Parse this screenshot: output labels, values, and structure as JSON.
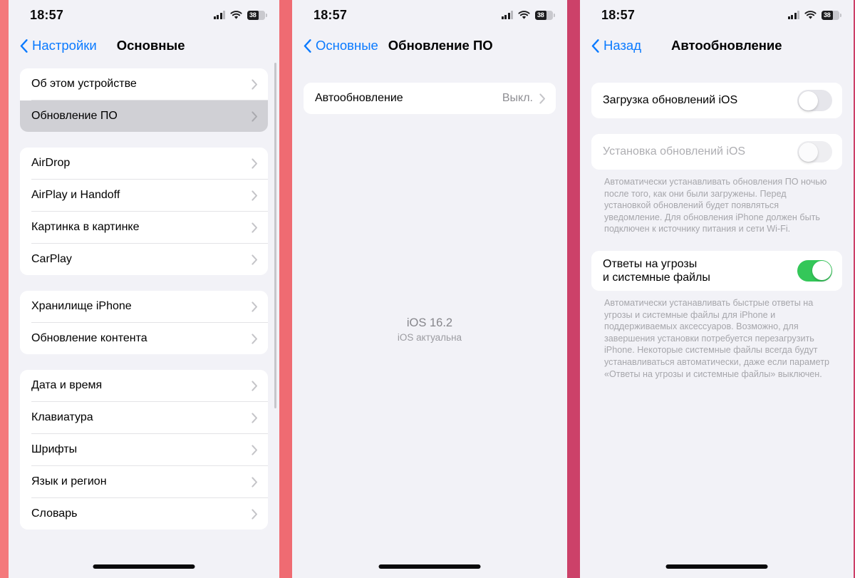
{
  "statusbar": {
    "time": "18:57",
    "battery_level": "38",
    "cell_icon": "cellular-signal-icon",
    "wifi_icon": "wifi-icon",
    "battery_icon": "battery-icon"
  },
  "screen1": {
    "back_label": "Настройки",
    "title": "Основные",
    "groups": [
      {
        "rows": [
          {
            "label": "Об этом устройстве",
            "selected": false
          },
          {
            "label": "Обновление ПО",
            "selected": true
          }
        ]
      },
      {
        "rows": [
          {
            "label": "AirDrop",
            "selected": false
          },
          {
            "label": "AirPlay и Handoff",
            "selected": false
          },
          {
            "label": "Картинка в картинке",
            "selected": false
          },
          {
            "label": "CarPlay",
            "selected": false
          }
        ]
      },
      {
        "rows": [
          {
            "label": "Хранилище iPhone",
            "selected": false
          },
          {
            "label": "Обновление контента",
            "selected": false
          }
        ]
      },
      {
        "rows": [
          {
            "label": "Дата и время",
            "selected": false
          },
          {
            "label": "Клавиатура",
            "selected": false
          },
          {
            "label": "Шрифты",
            "selected": false
          },
          {
            "label": "Язык и регион",
            "selected": false
          },
          {
            "label": "Словарь",
            "selected": false
          }
        ]
      }
    ]
  },
  "screen2": {
    "back_label": "Основные",
    "title": "Обновление ПО",
    "row": {
      "label": "Автообновление",
      "value": "Выкл."
    },
    "status": {
      "version": "iOS 16.2",
      "subtitle": "iOS актуальна"
    }
  },
  "screen3": {
    "back_label": "Назад",
    "title": "Автообновление",
    "toggle1": {
      "label": "Загрузка обновлений iOS",
      "state": "off",
      "disabled": false
    },
    "toggle2": {
      "label": "Установка обновлений iOS",
      "state": "off",
      "disabled": true
    },
    "footnote2": "Автоматически устанавливать обновления ПО ночью после того, как они были загружены. Перед установкой обновлений будет появляться уведомление. Для обновления iPhone должен быть подключен к источнику питания и сети Wi-Fi.",
    "toggle3": {
      "label_line1": "Ответы на угрозы",
      "label_line2": "и системные файлы",
      "state": "on",
      "disabled": false
    },
    "footnote3": "Автоматически устанавливать быстрые ответы на угрозы и системные файлы для iPhone и поддерживаемых аксессуаров. Возможно, для завершения установки потребуется перезагрузить iPhone. Некоторые системные файлы всегда будут устанавливаться автоматически, даже если параметр «Ответы на угрозы и системные файлы» выключен."
  },
  "colors": {
    "accent_blue": "#0a7aff",
    "toggle_on_green": "#34c759",
    "background": "#f2f2f7",
    "gutter_left": "#f4797c",
    "gutter_mid1": "#ef6b72",
    "gutter_mid2": "#cc4169",
    "gutter_right": "#cc3f68",
    "selected_row": "#d0d0d5"
  }
}
